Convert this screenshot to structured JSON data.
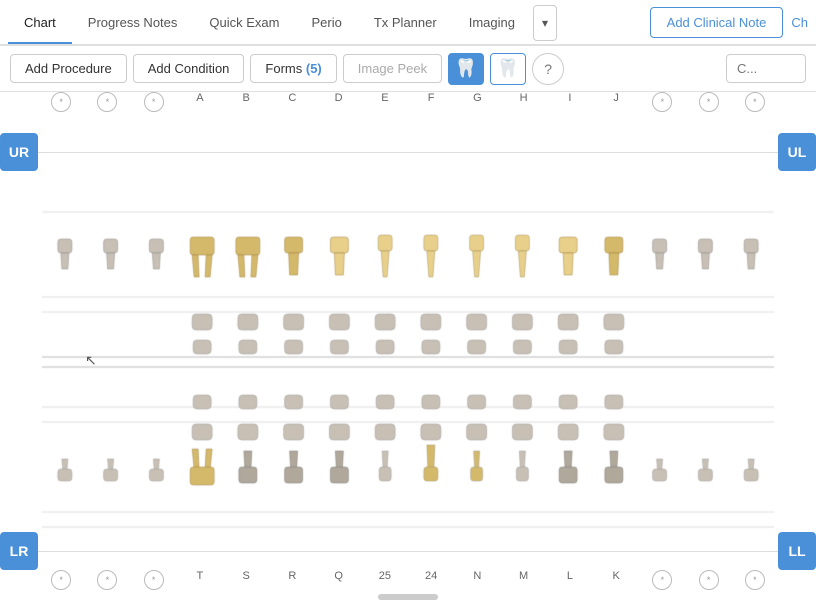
{
  "tabs": [
    {
      "id": "chart",
      "label": "Chart",
      "active": true
    },
    {
      "id": "progress-notes",
      "label": "Progress Notes",
      "active": false
    },
    {
      "id": "quick-exam",
      "label": "Quick Exam",
      "active": false
    },
    {
      "id": "perio",
      "label": "Perio",
      "active": false
    },
    {
      "id": "tx-planner",
      "label": "Tx Planner",
      "active": false
    },
    {
      "id": "imaging",
      "label": "Imaging",
      "active": false
    }
  ],
  "tab_more": "▾",
  "add_clinical_note": "Add Clinical Note",
  "ch_text": "Ch",
  "toolbar": {
    "add_procedure": "Add Procedure",
    "add_condition": "Add Condition",
    "forms": "Forms",
    "forms_count": "(5)",
    "image_peek": "Image Peek",
    "help": "?",
    "search_placeholder": "C..."
  },
  "quadrants": {
    "ur": "UR",
    "ul": "UL",
    "lr": "LR",
    "ll": "LL"
  },
  "upper_labels": [
    "*",
    "*",
    "*",
    "A",
    "B",
    "C",
    "D",
    "E",
    "F",
    "G",
    "H",
    "I",
    "J",
    "*",
    "*",
    "*"
  ],
  "lower_labels": [
    "*",
    "*",
    "*",
    "T",
    "S",
    "R",
    "Q",
    "25",
    "24",
    "N",
    "M",
    "L",
    "K",
    "*",
    "*",
    "*"
  ],
  "scrollbar_visible": true
}
